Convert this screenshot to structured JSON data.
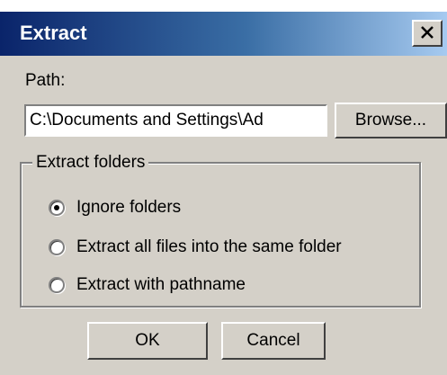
{
  "window": {
    "title": "Extract",
    "close_icon": "close-icon"
  },
  "path": {
    "label": "Path:",
    "value": "C:\\Documents and Settings\\Ad",
    "browse_label": "Browse..."
  },
  "extract_folders": {
    "legend": "Extract folders",
    "options": [
      {
        "label": "Ignore folders",
        "selected": true
      },
      {
        "label": "Extract all files into the same folder",
        "selected": false
      },
      {
        "label": "Extract with pathname",
        "selected": false
      }
    ]
  },
  "buttons": {
    "ok_label": "OK",
    "cancel_label": "Cancel"
  },
  "colors": {
    "titlebar_start": "#0a246a",
    "titlebar_end": "#a6caf0",
    "dialog_face": "#d4d0c8"
  }
}
